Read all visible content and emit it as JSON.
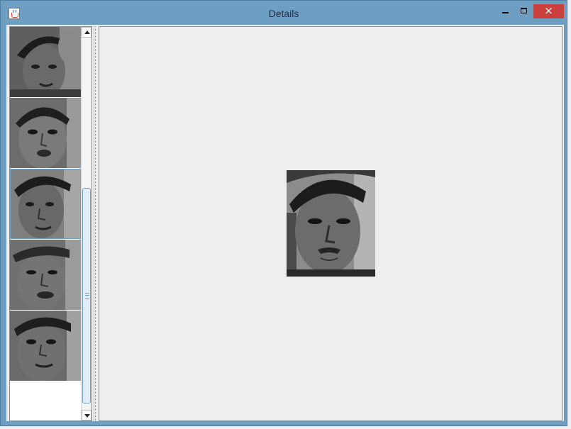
{
  "window": {
    "title": "Details"
  },
  "controls": {
    "minimize": "minimize",
    "maximize": "maximize",
    "close": "×"
  },
  "thumbnails": [
    {
      "icon": "face-photo",
      "selected": false
    },
    {
      "icon": "face-photo",
      "selected": false
    },
    {
      "icon": "face-photo",
      "selected": true
    },
    {
      "icon": "face-photo",
      "selected": false
    },
    {
      "icon": "face-photo",
      "selected": false
    }
  ],
  "scrollbar": {
    "position_fraction": 0.4
  },
  "preview": {
    "icon": "face-photo"
  }
}
